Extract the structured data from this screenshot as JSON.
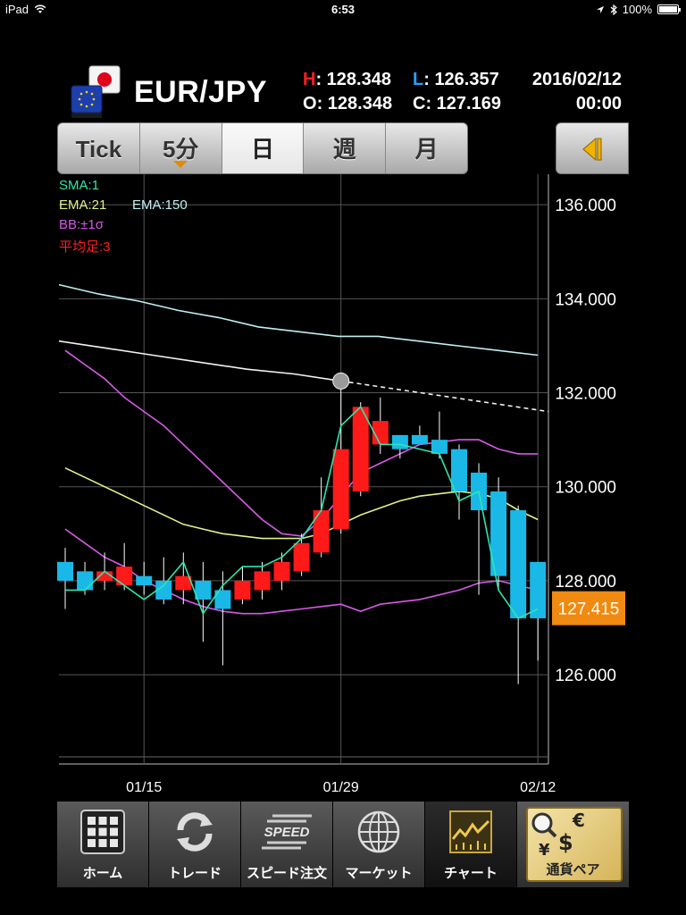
{
  "status_bar": {
    "device": "iPad",
    "time": "6:53",
    "battery": "100%"
  },
  "header": {
    "pair": "EUR/JPY",
    "high_key": "H",
    "high": "128.348",
    "low_key": "L",
    "low": "126.357",
    "open_key": "O",
    "open": "128.348",
    "close_key": "C",
    "close": "127.169",
    "date": "2016/02/12",
    "time": "00:00"
  },
  "tabs": [
    {
      "label": "Tick"
    },
    {
      "label": "5分"
    },
    {
      "label": "日",
      "active": true
    },
    {
      "label": "週"
    },
    {
      "label": "月"
    }
  ],
  "legend": {
    "sma": "SMA:1",
    "ema21": "EMA:21",
    "ema150": "EMA:150",
    "bb": "BB:±1σ",
    "heikin": "平均足:3"
  },
  "chart_data": {
    "type": "candlestick",
    "title": "",
    "y_ticks": [
      "136.000",
      "134.000",
      "132.000",
      "130.000",
      "128.000",
      "126.000"
    ],
    "x_ticks": [
      "01/15",
      "01/29",
      "02/12"
    ],
    "ylim": [
      124.1,
      136.65
    ],
    "current_price": "127.415",
    "grid": true,
    "colors": {
      "up": "#ff1a1a",
      "down": "#1ab8e6",
      "sma": "#2ee6b0",
      "ema21": "#dff28c",
      "ema150": "#f2f2f2",
      "bb": "#d65ae6",
      "ema150_upper": "#bff0f0",
      "price_tag": "#f08a10"
    },
    "candles": [
      {
        "o": 128.4,
        "h": 128.7,
        "l": 127.4,
        "c": 128.0
      },
      {
        "o": 128.2,
        "h": 128.4,
        "l": 127.7,
        "c": 127.8
      },
      {
        "o": 128.0,
        "h": 128.6,
        "l": 127.8,
        "c": 128.2
      },
      {
        "o": 127.9,
        "h": 128.8,
        "l": 127.8,
        "c": 128.3
      },
      {
        "o": 128.1,
        "h": 128.4,
        "l": 127.7,
        "c": 127.9
      },
      {
        "o": 128.0,
        "h": 128.5,
        "l": 127.5,
        "c": 127.6
      },
      {
        "o": 127.8,
        "h": 128.6,
        "l": 127.5,
        "c": 128.1
      },
      {
        "o": 128.0,
        "h": 128.4,
        "l": 126.7,
        "c": 127.6
      },
      {
        "o": 127.8,
        "h": 128.2,
        "l": 126.2,
        "c": 127.4
      },
      {
        "o": 127.6,
        "h": 128.3,
        "l": 127.5,
        "c": 128.0
      },
      {
        "o": 127.8,
        "h": 128.4,
        "l": 127.6,
        "c": 128.2
      },
      {
        "o": 128.0,
        "h": 128.6,
        "l": 127.8,
        "c": 128.4
      },
      {
        "o": 128.2,
        "h": 129.0,
        "l": 128.1,
        "c": 128.8
      },
      {
        "o": 128.6,
        "h": 130.2,
        "l": 128.5,
        "c": 129.5
      },
      {
        "o": 129.1,
        "h": 132.2,
        "l": 129.0,
        "c": 130.8
      },
      {
        "o": 129.9,
        "h": 131.8,
        "l": 129.8,
        "c": 131.7
      },
      {
        "o": 130.9,
        "h": 131.9,
        "l": 130.7,
        "c": 131.4
      },
      {
        "o": 131.1,
        "h": 131.1,
        "l": 130.6,
        "c": 130.8
      },
      {
        "o": 131.1,
        "h": 131.3,
        "l": 130.9,
        "c": 130.9
      },
      {
        "o": 131.0,
        "h": 131.6,
        "l": 130.6,
        "c": 130.7
      },
      {
        "o": 130.8,
        "h": 130.9,
        "l": 129.3,
        "c": 129.9
      },
      {
        "o": 130.3,
        "h": 130.5,
        "l": 127.7,
        "c": 129.5
      },
      {
        "o": 129.9,
        "h": 130.2,
        "l": 127.8,
        "c": 128.1
      },
      {
        "o": 129.5,
        "h": 129.6,
        "l": 125.8,
        "c": 127.2
      },
      {
        "o": 128.4,
        "h": 128.4,
        "l": 126.3,
        "c": 127.2
      }
    ],
    "sma": [
      127.8,
      127.8,
      128.2,
      127.9,
      127.6,
      127.9,
      128.4,
      127.3,
      127.9,
      128.3,
      128.3,
      128.5,
      128.9,
      129.5,
      131.3,
      131.7,
      130.9,
      130.9,
      130.8,
      130.7,
      129.7,
      129.9,
      127.8,
      127.2,
      127.4
    ],
    "ema21": [
      130.4,
      130.2,
      130.0,
      129.8,
      129.6,
      129.4,
      129.2,
      129.1,
      129.0,
      128.95,
      128.9,
      128.9,
      128.9,
      129.0,
      129.2,
      129.4,
      129.55,
      129.7,
      129.8,
      129.85,
      129.9,
      129.85,
      129.75,
      129.5,
      129.3
    ],
    "bb_upper": [
      132.9,
      132.6,
      132.3,
      131.9,
      131.6,
      131.3,
      130.9,
      130.5,
      130.1,
      129.7,
      129.3,
      129.0,
      128.95,
      129.3,
      129.8,
      130.3,
      130.5,
      130.7,
      130.9,
      130.95,
      131.0,
      131.0,
      130.8,
      130.7,
      130.7
    ],
    "bb_lower": [
      129.1,
      128.8,
      128.5,
      128.3,
      128.0,
      127.8,
      127.6,
      127.45,
      127.35,
      127.3,
      127.3,
      127.35,
      127.4,
      127.45,
      127.5,
      127.35,
      127.5,
      127.55,
      127.6,
      127.7,
      127.8,
      127.95,
      128.0,
      127.9,
      127.8
    ],
    "ema150": [
      133.1,
      132.95,
      132.8,
      132.65,
      132.5,
      132.4,
      132.25
    ],
    "ema150_upper": [
      134.3,
      134.1,
      133.95,
      133.75,
      133.6,
      133.4,
      133.3,
      133.2,
      133.2,
      133.1,
      133.0,
      132.9,
      132.8
    ]
  },
  "toolbar": [
    {
      "label": "ホーム",
      "icon": "home-grid-icon"
    },
    {
      "label": "トレード",
      "icon": "trade-refresh-icon"
    },
    {
      "label": "スピード注文",
      "icon": "speed-order-icon"
    },
    {
      "label": "マーケット",
      "icon": "market-globe-icon"
    },
    {
      "label": "チャート",
      "icon": "chart-icon",
      "active": true
    },
    {
      "label": "通貨ペア",
      "icon": "currency-pair-icon"
    }
  ],
  "currency_symbols": {
    "euro": "€",
    "dollar": "$",
    "yen": "¥"
  },
  "speed_badge": "SPEED"
}
